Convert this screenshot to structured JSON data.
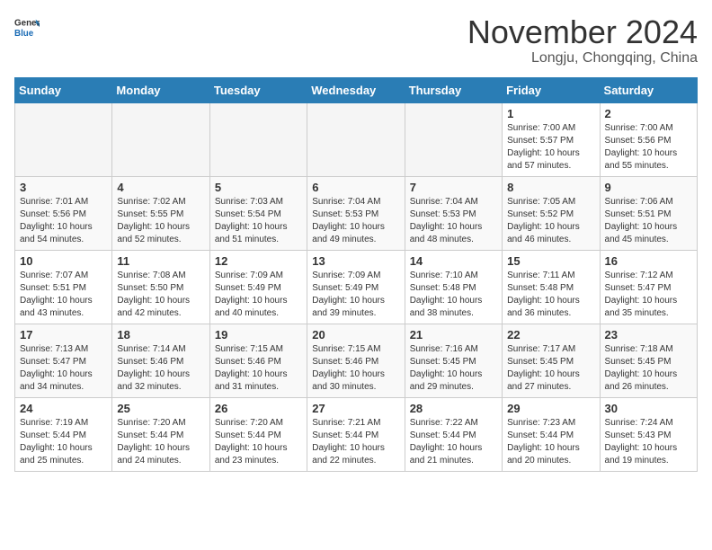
{
  "header": {
    "logo_general": "General",
    "logo_blue": "Blue",
    "month": "November 2024",
    "location": "Longju, Chongqing, China"
  },
  "weekdays": [
    "Sunday",
    "Monday",
    "Tuesday",
    "Wednesday",
    "Thursday",
    "Friday",
    "Saturday"
  ],
  "weeks": [
    [
      {
        "day": "",
        "info": ""
      },
      {
        "day": "",
        "info": ""
      },
      {
        "day": "",
        "info": ""
      },
      {
        "day": "",
        "info": ""
      },
      {
        "day": "",
        "info": ""
      },
      {
        "day": "1",
        "info": "Sunrise: 7:00 AM\nSunset: 5:57 PM\nDaylight: 10 hours\nand 57 minutes."
      },
      {
        "day": "2",
        "info": "Sunrise: 7:00 AM\nSunset: 5:56 PM\nDaylight: 10 hours\nand 55 minutes."
      }
    ],
    [
      {
        "day": "3",
        "info": "Sunrise: 7:01 AM\nSunset: 5:56 PM\nDaylight: 10 hours\nand 54 minutes."
      },
      {
        "day": "4",
        "info": "Sunrise: 7:02 AM\nSunset: 5:55 PM\nDaylight: 10 hours\nand 52 minutes."
      },
      {
        "day": "5",
        "info": "Sunrise: 7:03 AM\nSunset: 5:54 PM\nDaylight: 10 hours\nand 51 minutes."
      },
      {
        "day": "6",
        "info": "Sunrise: 7:04 AM\nSunset: 5:53 PM\nDaylight: 10 hours\nand 49 minutes."
      },
      {
        "day": "7",
        "info": "Sunrise: 7:04 AM\nSunset: 5:53 PM\nDaylight: 10 hours\nand 48 minutes."
      },
      {
        "day": "8",
        "info": "Sunrise: 7:05 AM\nSunset: 5:52 PM\nDaylight: 10 hours\nand 46 minutes."
      },
      {
        "day": "9",
        "info": "Sunrise: 7:06 AM\nSunset: 5:51 PM\nDaylight: 10 hours\nand 45 minutes."
      }
    ],
    [
      {
        "day": "10",
        "info": "Sunrise: 7:07 AM\nSunset: 5:51 PM\nDaylight: 10 hours\nand 43 minutes."
      },
      {
        "day": "11",
        "info": "Sunrise: 7:08 AM\nSunset: 5:50 PM\nDaylight: 10 hours\nand 42 minutes."
      },
      {
        "day": "12",
        "info": "Sunrise: 7:09 AM\nSunset: 5:49 PM\nDaylight: 10 hours\nand 40 minutes."
      },
      {
        "day": "13",
        "info": "Sunrise: 7:09 AM\nSunset: 5:49 PM\nDaylight: 10 hours\nand 39 minutes."
      },
      {
        "day": "14",
        "info": "Sunrise: 7:10 AM\nSunset: 5:48 PM\nDaylight: 10 hours\nand 38 minutes."
      },
      {
        "day": "15",
        "info": "Sunrise: 7:11 AM\nSunset: 5:48 PM\nDaylight: 10 hours\nand 36 minutes."
      },
      {
        "day": "16",
        "info": "Sunrise: 7:12 AM\nSunset: 5:47 PM\nDaylight: 10 hours\nand 35 minutes."
      }
    ],
    [
      {
        "day": "17",
        "info": "Sunrise: 7:13 AM\nSunset: 5:47 PM\nDaylight: 10 hours\nand 34 minutes."
      },
      {
        "day": "18",
        "info": "Sunrise: 7:14 AM\nSunset: 5:46 PM\nDaylight: 10 hours\nand 32 minutes."
      },
      {
        "day": "19",
        "info": "Sunrise: 7:15 AM\nSunset: 5:46 PM\nDaylight: 10 hours\nand 31 minutes."
      },
      {
        "day": "20",
        "info": "Sunrise: 7:15 AM\nSunset: 5:46 PM\nDaylight: 10 hours\nand 30 minutes."
      },
      {
        "day": "21",
        "info": "Sunrise: 7:16 AM\nSunset: 5:45 PM\nDaylight: 10 hours\nand 29 minutes."
      },
      {
        "day": "22",
        "info": "Sunrise: 7:17 AM\nSunset: 5:45 PM\nDaylight: 10 hours\nand 27 minutes."
      },
      {
        "day": "23",
        "info": "Sunrise: 7:18 AM\nSunset: 5:45 PM\nDaylight: 10 hours\nand 26 minutes."
      }
    ],
    [
      {
        "day": "24",
        "info": "Sunrise: 7:19 AM\nSunset: 5:44 PM\nDaylight: 10 hours\nand 25 minutes."
      },
      {
        "day": "25",
        "info": "Sunrise: 7:20 AM\nSunset: 5:44 PM\nDaylight: 10 hours\nand 24 minutes."
      },
      {
        "day": "26",
        "info": "Sunrise: 7:20 AM\nSunset: 5:44 PM\nDaylight: 10 hours\nand 23 minutes."
      },
      {
        "day": "27",
        "info": "Sunrise: 7:21 AM\nSunset: 5:44 PM\nDaylight: 10 hours\nand 22 minutes."
      },
      {
        "day": "28",
        "info": "Sunrise: 7:22 AM\nSunset: 5:44 PM\nDaylight: 10 hours\nand 21 minutes."
      },
      {
        "day": "29",
        "info": "Sunrise: 7:23 AM\nSunset: 5:44 PM\nDaylight: 10 hours\nand 20 minutes."
      },
      {
        "day": "30",
        "info": "Sunrise: 7:24 AM\nSunset: 5:43 PM\nDaylight: 10 hours\nand 19 minutes."
      }
    ]
  ]
}
